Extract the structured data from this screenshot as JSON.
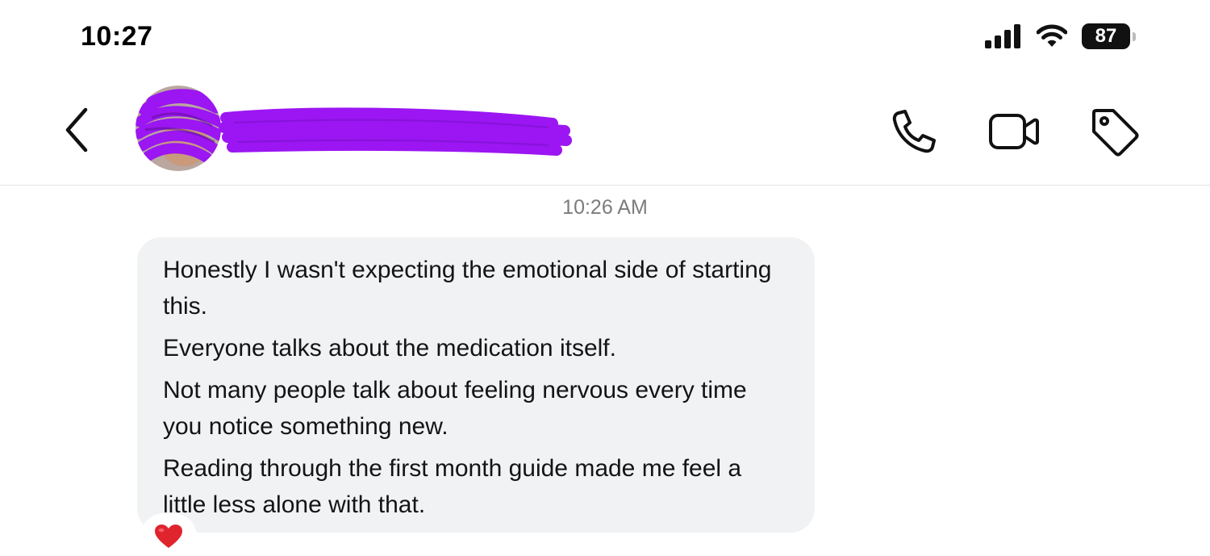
{
  "status_bar": {
    "time": "10:27",
    "battery_level": "87",
    "icons": [
      "signal-icon",
      "wifi-icon",
      "battery-icon"
    ]
  },
  "header": {
    "contact_name_redacted": true,
    "icons": [
      "back-chevron-icon",
      "phone-icon",
      "video-camera-icon",
      "tag-icon"
    ]
  },
  "conversation": {
    "timestamp": "10:26 AM",
    "message": {
      "paragraphs": [
        "Honestly I wasn't expecting the emotional side of starting this.",
        "Everyone talks about the medication itself.",
        "Not many people talk about feeling nervous every time you notice something new.",
        "Reading through the first month guide made me feel a little less alone with that."
      ],
      "reaction_icon": "heart-icon"
    }
  },
  "colors": {
    "redaction": "#9b16f2",
    "bubble": "#f1f2f4",
    "timestamp_text": "#7c7c7c",
    "heart": "#e0242e"
  }
}
